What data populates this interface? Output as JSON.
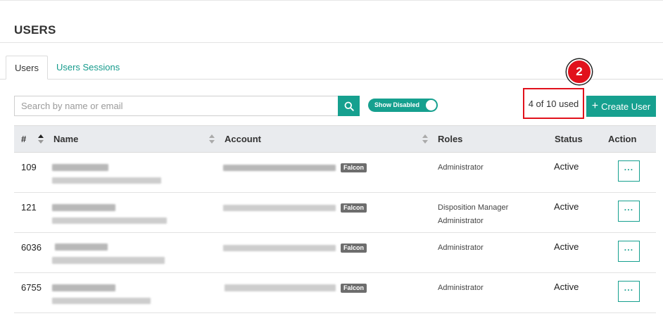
{
  "page": {
    "title": "USERS"
  },
  "tabs": [
    {
      "label": "Users",
      "active": true
    },
    {
      "label": "Users Sessions",
      "active": false
    }
  ],
  "search": {
    "placeholder": "Search by name or email",
    "value": "",
    "icon": "search-icon"
  },
  "toggle": {
    "label": "Show Disabled",
    "on": true
  },
  "usage": {
    "text": "4 of 10 used",
    "used": 4,
    "total": 10
  },
  "step_badge": "2",
  "create_button": {
    "label": "Create User",
    "icon": "plus-icon"
  },
  "table": {
    "columns": [
      "#",
      "Name",
      "Account",
      "Roles",
      "Status",
      "Action"
    ],
    "action_label": "···",
    "account_tag": "Falcon",
    "rows": [
      {
        "id": "109",
        "roles": [
          "Administrator"
        ],
        "status": "Active"
      },
      {
        "id": "121",
        "roles": [
          "Disposition Manager",
          "Administrator"
        ],
        "status": "Active"
      },
      {
        "id": "6036",
        "roles": [
          "Administrator"
        ],
        "status": "Active"
      },
      {
        "id": "6755",
        "roles": [
          "Administrator"
        ],
        "status": "Active"
      }
    ]
  },
  "colors": {
    "accent": "#16a08f",
    "highlight": "#e1111c",
    "header_bg": "#e9ebee"
  }
}
